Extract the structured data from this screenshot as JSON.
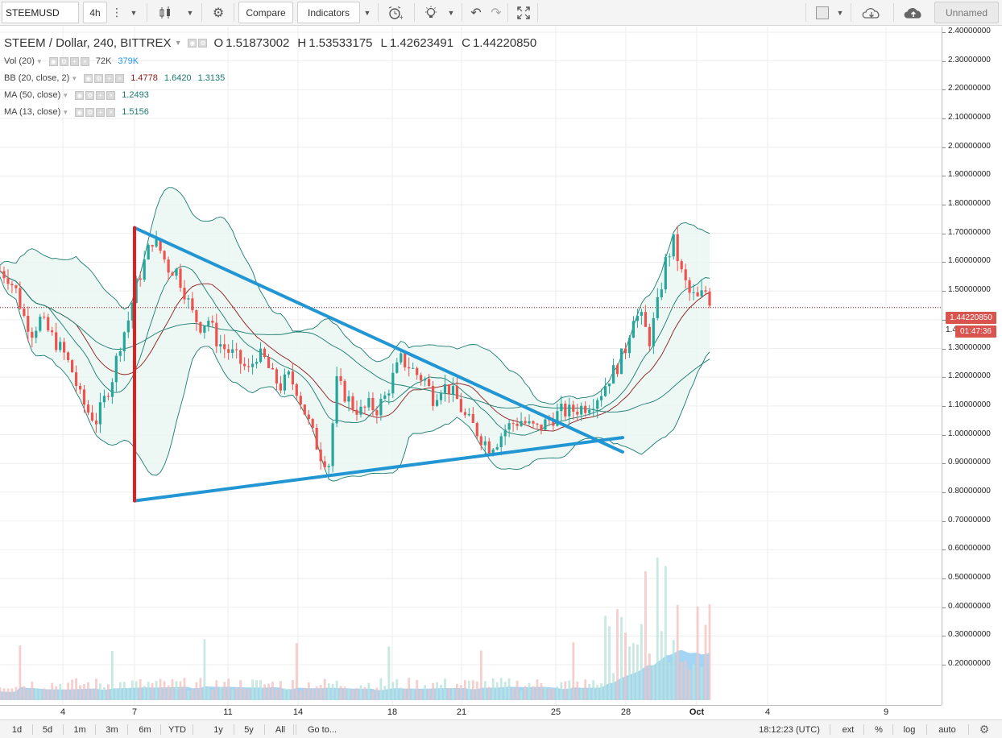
{
  "toolbar": {
    "symbol": "STEEMUSD",
    "interval": "4h",
    "compare_label": "Compare",
    "indicators_label": "Indicators",
    "layout_name": "Unnamed",
    "icons": [
      "more-vertical-icon",
      "candles-icon",
      "gear-icon",
      "alarm-clock-icon",
      "lightbulb-icon",
      "undo-icon",
      "redo-icon",
      "fullscreen-icon",
      "color-square-icon",
      "cloud-download-icon",
      "cloud-upload-icon"
    ]
  },
  "legend": {
    "title": "STEEM / Dollar, 240, BITTREX",
    "o_label": "O",
    "o": "1.51873002",
    "h_label": "H",
    "h": "1.53533175",
    "l_label": "L",
    "l": "1.42623491",
    "c_label": "C",
    "c": "1.44220850",
    "vol_label": "Vol (20)",
    "vol_v1": "72K",
    "vol_v2": "379K",
    "bb_label": "BB (20, close, 2)",
    "bb_v1": "1.4778",
    "bb_v2": "1.6420",
    "bb_v3": "1.3135",
    "ma50_label": "MA (50, close)",
    "ma50_v": "1.2493",
    "ma13_label": "MA (13, close)",
    "ma13_v": "1.5156",
    "colors": {
      "vol2": "#2196f3",
      "bb1": "#8b1a1a",
      "bb2": "#1b7a6e",
      "bb3": "#1b7a6e",
      "ma50": "#1b7a6e",
      "ma13": "#1b7a6e"
    }
  },
  "price_scale": {
    "ticks": [
      "2.40000000",
      "2.30000000",
      "2.20000000",
      "2.10000000",
      "2.00000000",
      "1.90000000",
      "1.80000000",
      "1.70000000",
      "1.60000000",
      "1.50000000",
      "1.40000000",
      "1.30000000",
      "1.20000000",
      "1.10000000",
      "1.00000000",
      "0.90000000",
      "0.80000000",
      "0.70000000",
      "0.60000000",
      "0.50000000",
      "0.40000000",
      "0.30000000",
      "0.20000000"
    ],
    "last_price": "1.44220850",
    "countdown_prefix": "1.4",
    "countdown": "01:47:36"
  },
  "time_scale": {
    "ticks": [
      "4",
      "7",
      "11",
      "14",
      "18",
      "21",
      "25",
      "28",
      "Oct",
      "4",
      "9"
    ]
  },
  "bottom_bar": {
    "ranges": [
      "1d",
      "5d",
      "1m",
      "3m",
      "6m",
      "YTD",
      "1y",
      "5y",
      "All"
    ],
    "goto_label": "Go to...",
    "clock": "18:12:23 (UTC)",
    "ext_label": "ext",
    "percent_label": "%",
    "log_label": "log",
    "auto_label": "auto"
  },
  "chart_data": {
    "type": "candlestick",
    "symbol": "STEEM / Dollar, 240, BITTREX",
    "ylim": [
      0.15,
      2.43
    ],
    "x_tick_labels": [
      "4",
      "7",
      "11",
      "14",
      "18",
      "21",
      "25",
      "28",
      "Oct",
      "4",
      "9"
    ],
    "grid": true,
    "colors": {
      "up": "#26a69a",
      "down": "#ef5350",
      "band_fill": "#e8f6f3",
      "band_line": "#1b7a6e",
      "basis": "#8b1a1a",
      "ma": "#1b7a6e",
      "volume": "#87c7f0",
      "trendline": "#2196d3",
      "vertical": "#e02020",
      "last_price_line": "#8b1a1a"
    },
    "price_path": [
      [
        0,
        1.57
      ],
      [
        5,
        1.55
      ],
      [
        10,
        1.5
      ],
      [
        15,
        1.41
      ],
      [
        20,
        1.36
      ],
      [
        25,
        1.4
      ],
      [
        30,
        1.36
      ],
      [
        35,
        1.32
      ],
      [
        40,
        1.28
      ],
      [
        45,
        1.22
      ],
      [
        50,
        1.13
      ],
      [
        55,
        1.08
      ],
      [
        60,
        1.05
      ],
      [
        65,
        1.12
      ],
      [
        70,
        1.2
      ],
      [
        75,
        1.32
      ],
      [
        80,
        1.4
      ],
      [
        85,
        1.52
      ],
      [
        90,
        1.6
      ],
      [
        95,
        1.68
      ],
      [
        100,
        1.64
      ],
      [
        105,
        1.58
      ],
      [
        110,
        1.57
      ],
      [
        115,
        1.5
      ],
      [
        120,
        1.42
      ],
      [
        125,
        1.38
      ],
      [
        130,
        1.4
      ],
      [
        135,
        1.33
      ],
      [
        140,
        1.3
      ],
      [
        145,
        1.28
      ],
      [
        150,
        1.25
      ],
      [
        155,
        1.22
      ],
      [
        160,
        1.28
      ],
      [
        165,
        1.26
      ],
      [
        170,
        1.2
      ],
      [
        175,
        1.17
      ],
      [
        180,
        1.2
      ],
      [
        185,
        1.16
      ],
      [
        190,
        1.08
      ],
      [
        195,
        1.0
      ],
      [
        200,
        0.93
      ],
      [
        205,
        0.9
      ],
      [
        210,
        1.18
      ],
      [
        215,
        1.14
      ],
      [
        220,
        1.1
      ],
      [
        225,
        1.08
      ],
      [
        230,
        1.1
      ],
      [
        235,
        1.09
      ],
      [
        240,
        1.13
      ],
      [
        245,
        1.2
      ],
      [
        250,
        1.26
      ],
      [
        255,
        1.24
      ],
      [
        260,
        1.21
      ],
      [
        265,
        1.19
      ],
      [
        270,
        1.13
      ],
      [
        275,
        1.17
      ],
      [
        280,
        1.16
      ],
      [
        285,
        1.12
      ],
      [
        290,
        1.06
      ],
      [
        295,
        1.03
      ],
      [
        300,
        0.99
      ],
      [
        305,
        0.96
      ],
      [
        310,
        0.98
      ],
      [
        315,
        1.02
      ],
      [
        320,
        1.04
      ],
      [
        325,
        1.05
      ],
      [
        330,
        1.03
      ],
      [
        335,
        1.02
      ],
      [
        340,
        1.04
      ],
      [
        345,
        1.06
      ],
      [
        350,
        1.08
      ],
      [
        355,
        1.08
      ],
      [
        360,
        1.09
      ],
      [
        365,
        1.1
      ],
      [
        370,
        1.12
      ],
      [
        375,
        1.15
      ],
      [
        380,
        1.2
      ],
      [
        385,
        1.24
      ],
      [
        390,
        1.3
      ],
      [
        395,
        1.42
      ],
      [
        400,
        1.4
      ],
      [
        405,
        1.33
      ],
      [
        410,
        1.45
      ],
      [
        415,
        1.6
      ],
      [
        420,
        1.67
      ],
      [
        425,
        1.56
      ],
      [
        430,
        1.49
      ],
      [
        435,
        1.47
      ],
      [
        440,
        1.5
      ],
      [
        445,
        1.44
      ]
    ],
    "bollinger": {
      "period": 20,
      "stddev": 2,
      "basis": 1.4778,
      "upper": 1.642,
      "lower": 1.3135
    },
    "ma50": 1.2493,
    "ma13": 1.5156,
    "volume_last": "72K",
    "volume_ma": "379K",
    "drawings": [
      {
        "type": "trendline",
        "from": [
          "7",
          1.72
        ],
        "to": [
          "27",
          0.94
        ]
      },
      {
        "type": "trendline",
        "from": [
          "7",
          0.77
        ],
        "to": [
          "27",
          0.99
        ]
      },
      {
        "type": "vertical",
        "from": [
          "7",
          0.77
        ],
        "to": [
          "7",
          1.72
        ]
      }
    ]
  }
}
